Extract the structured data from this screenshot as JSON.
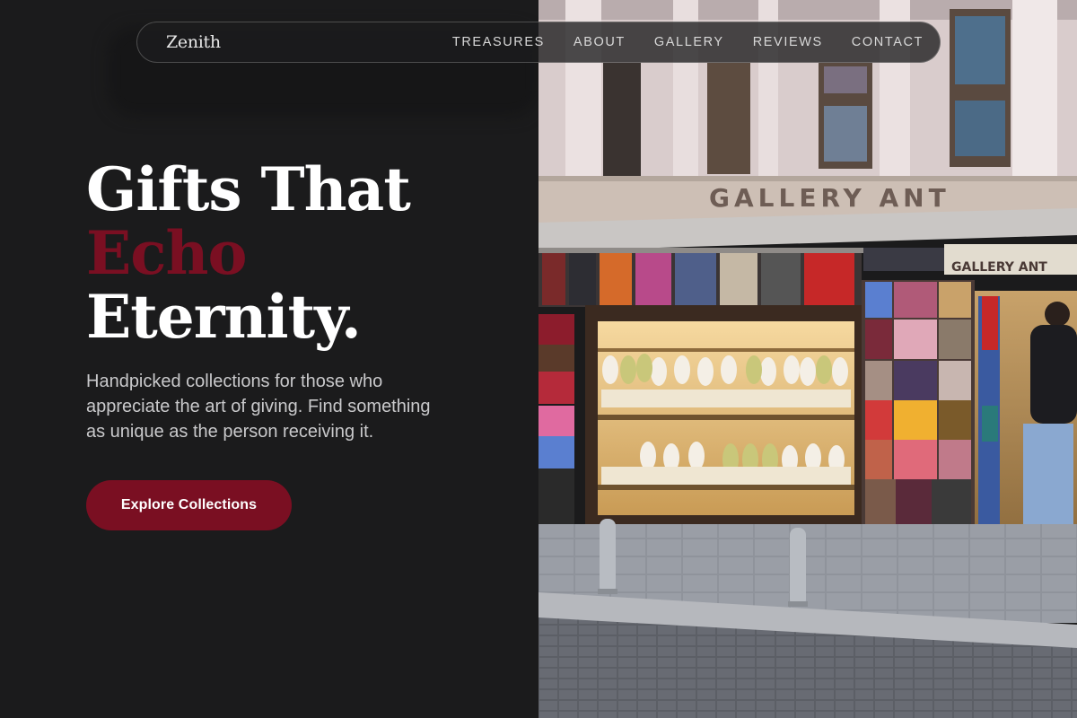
{
  "brand": {
    "name": "Zenith"
  },
  "nav": {
    "links": [
      "TREASURES",
      "ABOUT",
      "GALLERY",
      "REVIEWS",
      "CONTACT"
    ]
  },
  "hero": {
    "title_line1": "Gifts That",
    "title_accent": "Echo",
    "title_line3": "Eternity.",
    "subtitle": "Handpicked collections for those who appreciate the art of giving. Find something as unique as the person receiving it.",
    "cta_label": "Explore Collections"
  },
  "photo": {
    "shop_sign": "GALLERY ANT",
    "small_sign": "GALLERY ANT"
  },
  "colors": {
    "background": "#1b1b1c",
    "accent": "#7a0f22",
    "text": "#ffffff",
    "muted_text": "#c9c9cb"
  }
}
